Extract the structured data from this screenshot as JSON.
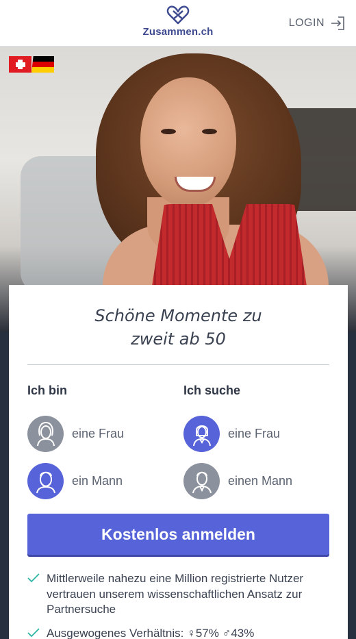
{
  "header": {
    "brand": "Zusammen.ch",
    "login_label": "LOGIN"
  },
  "flags": [
    "swiss-flag",
    "german-flag"
  ],
  "card": {
    "headline_line1": "Schöne Momente zu",
    "headline_line2": "zweit ab 50",
    "i_am": {
      "title": "Ich bin",
      "options": [
        {
          "label": "eine Frau",
          "icon": "woman-avatar-icon",
          "selected": false
        },
        {
          "label": "ein Mann",
          "icon": "man-avatar-icon",
          "selected": true
        }
      ]
    },
    "looking_for": {
      "title": "Ich suche",
      "options": [
        {
          "label": "eine Frau",
          "icon": "woman-avatar-icon",
          "selected": true
        },
        {
          "label": "einen Mann",
          "icon": "man-avatar-icon",
          "selected": false
        }
      ]
    },
    "cta_label": "Kostenlos anmelden",
    "benefits": [
      "Mittlerweile nahezu eine Million registrierte Nutzer vertrauen unserem wissenschaftlichen Ansatz zur Partnersuche",
      "Ausgewogenes Verhältnis: ♀57% ♂43%"
    ]
  },
  "colors": {
    "accent": "#5763d8",
    "avatar_unselected": "#8c929d",
    "check": "#2bb5a5",
    "logo": "#3e4a8f"
  }
}
